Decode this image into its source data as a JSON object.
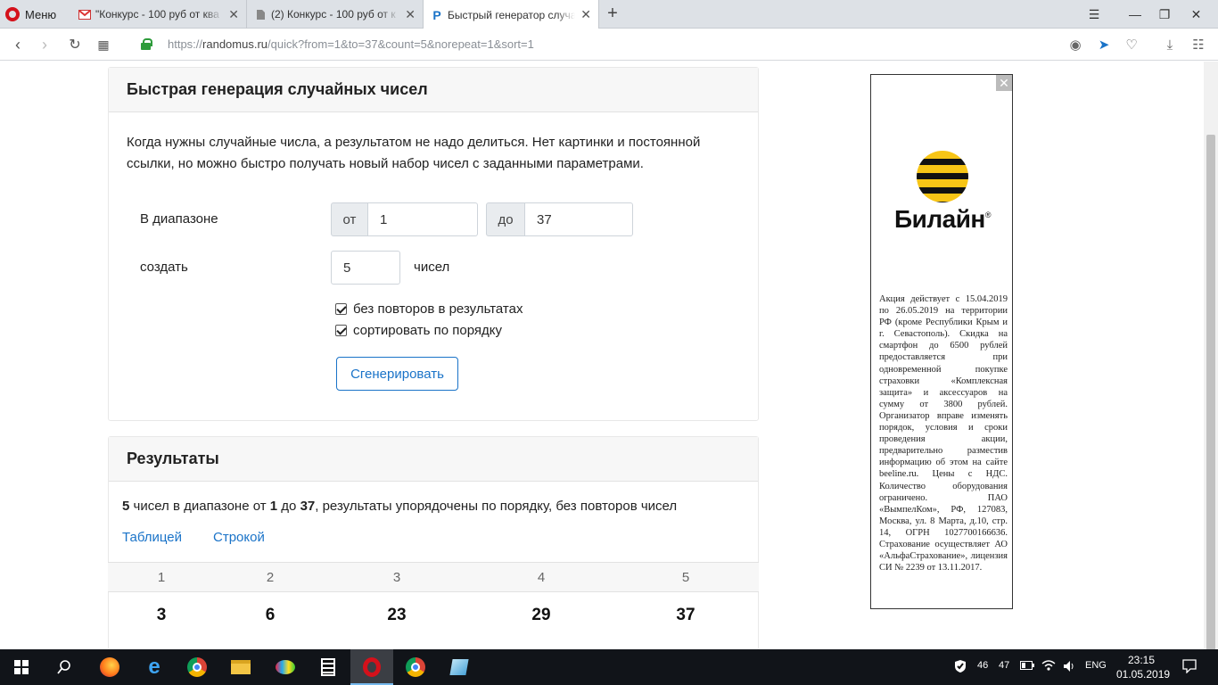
{
  "browser": {
    "menu_label": "Меню",
    "tabs": [
      {
        "title": "\"Конкурс - 100 руб от ква",
        "icon": "gmail-icon"
      },
      {
        "title": "(2) Конкурс - 100 руб от к",
        "icon": "document-icon"
      },
      {
        "title": "Быстрый генератор случа",
        "icon": "randomus-icon",
        "active": true
      }
    ],
    "url_prefix": "https://",
    "url_domain": "randomus.ru",
    "url_path": "/quick?from=1&to=37&count=5&norepeat=1&sort=1"
  },
  "form": {
    "title": "Быстрая генерация случайных чисел",
    "description": "Когда нужны случайные числа, а результатом не надо делиться. Нет картинки и постоянной ссылки, но можно быстро получать новый набор чисел с заданными параметрами.",
    "range_label": "В диапазоне",
    "from_label": "от",
    "from_value": "1",
    "to_label": "до",
    "to_value": "37",
    "create_label": "создать",
    "count_value": "5",
    "count_suffix": "чисел",
    "norepeat_label": "без повторов в результатах",
    "norepeat_checked": true,
    "sort_label": "сортировать по порядку",
    "sort_checked": true,
    "generate_button": "Сгенерировать"
  },
  "results": {
    "title": "Результаты",
    "summary_count": "5",
    "summary_text1": " чисел в диапазоне от ",
    "summary_from": "1",
    "summary_text2": " до ",
    "summary_to": "37",
    "summary_text3": ", результаты упорядочены по порядку, без повторов чисел",
    "view_table": "Таблицей",
    "view_line": "Строкой",
    "columns": [
      "1",
      "2",
      "3",
      "4",
      "5"
    ],
    "values": [
      "3",
      "6",
      "23",
      "29",
      "37"
    ]
  },
  "ad": {
    "brand": "Билайн",
    "trademark": "®",
    "text": "Акция действует с 15.04.2019 по 26.05.2019 на территории РФ (кроме Республики Крым и г. Севастополь). Скидка на смартфон до 6500 рублей предоставляется при одновременной покупке страховки «Комплексная защита» и аксессуаров на сумму от 3800 рублей. Организатор вправе изменять порядок, условия и сроки проведения акции, предварительно разместив информацию об этом на сайте beeline.ru. Цены с НДС. Количество оборудования ограничено. ПАО «ВымпелКом», РФ, 127083, Москва, ул. 8 Марта, д.10, стр. 14, ОГРН 1027700166636. Страхование осуществляет АО «АльфаСтрахование», лицензия СИ № 2239 от 13.11.2017."
  },
  "taskbar": {
    "tray_num1": "46",
    "tray_num2": "47",
    "language": "ENG",
    "time": "23:15",
    "date": "01.05.2019"
  }
}
